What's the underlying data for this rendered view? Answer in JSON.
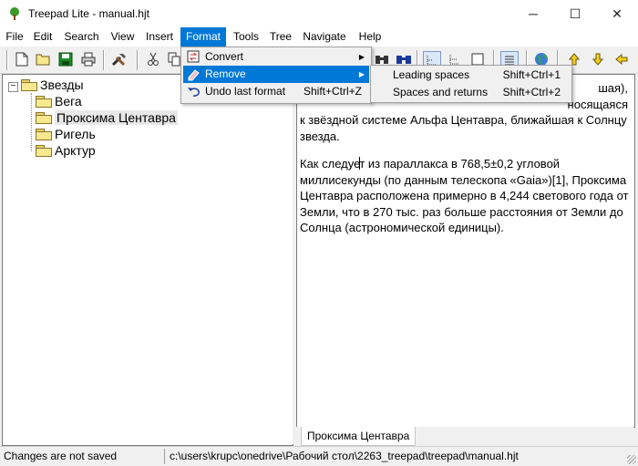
{
  "window": {
    "title": "Treepad Lite - manual.hjt",
    "minimize": "─",
    "maximize": "☐",
    "close": "✕"
  },
  "menu": {
    "items": [
      "File",
      "Edit",
      "Search",
      "View",
      "Insert",
      "Format",
      "Tools",
      "Tree",
      "Navigate",
      "Help"
    ],
    "active": "Format"
  },
  "format_menu": {
    "convert": "Convert",
    "remove": "Remove",
    "undo": "Undo last format",
    "undo_shortcut": "Shift+Ctrl+Z"
  },
  "remove_submenu": {
    "leading": "Leading spaces",
    "leading_shortcut": "Shift+Ctrl+1",
    "spaces_returns": "Spaces and returns",
    "spaces_returns_shortcut": "Shift+Ctrl+2"
  },
  "tree": {
    "root": "Звезды",
    "expander": "−",
    "children": [
      "Вега",
      "Проксима Центавра",
      "Ригель",
      "Арктур"
    ],
    "selected_index": 1
  },
  "document": {
    "line1_tail": "шая),",
    "line2_tail": "носящаяся",
    "line3": "к звёздной системе Альфа Центавра, ближайшая к Солнцу",
    "line4": "звезда.",
    "p2_before_caret": "Как следуе",
    "p2_after_caret": "т из параллакса в 768,5±0,2 угловой",
    "p2_line2": "миллисекунды (по данным телескопа «Gaia»)[1], Проксима",
    "p2_line3": "Центавра расположена примерно в 4,244 светового года от",
    "p2_line4": "Земли, что в 270 тыс. раз больше расстояния от Земли до",
    "p2_line5": "Солнца (астрономической единицы)."
  },
  "tab": {
    "label": "Проксима Центавра"
  },
  "status": {
    "left": "Changes are not saved",
    "path": "c:\\users\\krupc\\onedrive\\Рабочий стол\\2263_treepad\\treepad\\manual.hjt"
  },
  "colors": {
    "menu_highlight": "#0078d7",
    "folder_fill": "#f8e890",
    "toolbar_bg": "#f0f0f0"
  }
}
